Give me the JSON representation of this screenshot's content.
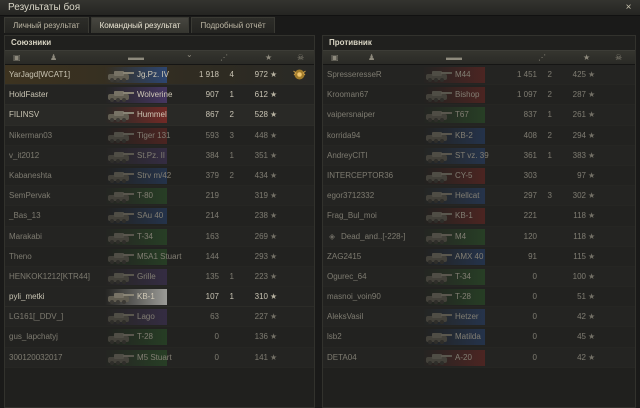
{
  "window": {
    "title": "Результаты боя",
    "close": "×"
  },
  "tabs": [
    "Личный результат",
    "Командный результат",
    "Подробный отчёт"
  ],
  "allies": {
    "title": "Союзники",
    "rows": [
      {
        "name": "YarJagd[WCAT1]",
        "vehicle": "Jg.Pz. IV",
        "damage": "1 918",
        "kills": "4",
        "xp": "972",
        "nation": "blue",
        "me": true,
        "medal": true
      },
      {
        "name": "HoldFaster",
        "vehicle": "Wolverine",
        "damage": "907",
        "kills": "1",
        "xp": "612",
        "nation": "purple"
      },
      {
        "name": "FILINSV",
        "vehicle": "Hummel",
        "damage": "867",
        "kills": "2",
        "xp": "528",
        "nation": "red"
      },
      {
        "name": "Nikerman03",
        "vehicle": "Tiger 131",
        "damage": "593",
        "kills": "3",
        "xp": "448",
        "nation": "red",
        "dead": true
      },
      {
        "name": "v_it2012",
        "vehicle": "St.Pz. II",
        "damage": "384",
        "kills": "1",
        "xp": "351",
        "nation": "purple",
        "dead": true
      },
      {
        "name": "Kabaneshta",
        "vehicle": "Strv m/42",
        "damage": "379",
        "kills": "2",
        "xp": "434",
        "nation": "blue",
        "dead": true
      },
      {
        "name": "SemPervak",
        "vehicle": "T-80",
        "damage": "219",
        "kills": "",
        "xp": "319",
        "nation": "green",
        "dead": true
      },
      {
        "name": "_Bas_13",
        "vehicle": "SAu 40",
        "damage": "214",
        "kills": "",
        "xp": "238",
        "nation": "blue",
        "dead": true
      },
      {
        "name": "Marakabi",
        "vehicle": "T-34",
        "damage": "163",
        "kills": "",
        "xp": "269",
        "nation": "green",
        "dead": true
      },
      {
        "name": "Theno",
        "vehicle": "M5A1 Stuart",
        "damage": "144",
        "kills": "",
        "xp": "293",
        "nation": "green",
        "dead": true
      },
      {
        "name": "HENKOK1212[KTR44]",
        "vehicle": "Grille",
        "damage": "135",
        "kills": "1",
        "xp": "223",
        "nation": "purple",
        "dead": true
      },
      {
        "name": "pyli_metki",
        "vehicle": "KB-1",
        "damage": "107",
        "kills": "1",
        "xp": "310",
        "nation": "white"
      },
      {
        "name": "LG161[_DDV_]",
        "vehicle": "Lago",
        "damage": "63",
        "kills": "",
        "xp": "227",
        "nation": "purple",
        "dead": true
      },
      {
        "name": "gus_lapchatyj",
        "vehicle": "T-28",
        "damage": "0",
        "kills": "",
        "xp": "136",
        "nation": "green",
        "dead": true
      },
      {
        "name": "300120032017",
        "vehicle": "M5 Stuart",
        "damage": "0",
        "kills": "",
        "xp": "141",
        "nation": "green",
        "dead": true
      }
    ]
  },
  "enemies": {
    "title": "Противник",
    "rows": [
      {
        "name": "SpresseresseR",
        "vehicle": "M44",
        "damage": "1 451",
        "kills": "2",
        "xp": "425",
        "nation": "red",
        "dead": true
      },
      {
        "name": "Krooman67",
        "vehicle": "Bishop",
        "damage": "1 097",
        "kills": "2",
        "xp": "287",
        "nation": "red",
        "dead": true
      },
      {
        "name": "vaipersnaiper",
        "vehicle": "T67",
        "damage": "837",
        "kills": "1",
        "xp": "261",
        "nation": "green",
        "dead": true
      },
      {
        "name": "korrida94",
        "vehicle": "KB-2",
        "damage": "408",
        "kills": "2",
        "xp": "294",
        "nation": "blue",
        "dead": true
      },
      {
        "name": "AndreyCITI",
        "vehicle": "ST vz. 39",
        "damage": "361",
        "kills": "1",
        "xp": "383",
        "nation": "blue",
        "dead": true
      },
      {
        "name": "INTERCEPTOR36",
        "vehicle": "CY-5",
        "damage": "303",
        "kills": "",
        "xp": "97",
        "nation": "red",
        "dead": true
      },
      {
        "name": "egor3712332",
        "vehicle": "Hellcat",
        "damage": "297",
        "kills": "3",
        "xp": "302",
        "nation": "blue",
        "dead": true
      },
      {
        "name": "Frag_Bul_moi",
        "vehicle": "KB-1",
        "damage": "221",
        "kills": "",
        "xp": "118",
        "nation": "red",
        "dead": true
      },
      {
        "name": "Dead_and..[-228-]",
        "vehicle": "M4",
        "damage": "120",
        "kills": "",
        "xp": "118",
        "nation": "green",
        "dead": true,
        "clan": true
      },
      {
        "name": "ZAG2415",
        "vehicle": "AMX 40",
        "damage": "91",
        "kills": "",
        "xp": "115",
        "nation": "blue",
        "dead": true
      },
      {
        "name": "Ogurec_64",
        "vehicle": "T-34",
        "damage": "0",
        "kills": "",
        "xp": "100",
        "nation": "green",
        "dead": true
      },
      {
        "name": "masnoi_voin90",
        "vehicle": "T-28",
        "damage": "0",
        "kills": "",
        "xp": "51",
        "nation": "green",
        "dead": true
      },
      {
        "name": "AleksVasil",
        "vehicle": "Hetzer",
        "damage": "0",
        "kills": "",
        "xp": "42",
        "nation": "blue",
        "dead": true
      },
      {
        "name": "lsb2",
        "vehicle": "Matilda",
        "damage": "0",
        "kills": "",
        "xp": "45",
        "nation": "blue",
        "dead": true
      },
      {
        "name": "DETA04",
        "vehicle": "A-20",
        "damage": "0",
        "kills": "",
        "xp": "42",
        "nation": "red",
        "dead": true
      }
    ]
  },
  "colors": {
    "blue": "#2b4f8e",
    "red": "#8d2a26",
    "green": "#2f6a2e",
    "purple": "#523d79",
    "white": "#c9c9c4"
  },
  "icons": [
    "tank-icon",
    "star-icon",
    "medal-icon",
    "skull-icon",
    "sort-arrow-icon"
  ]
}
